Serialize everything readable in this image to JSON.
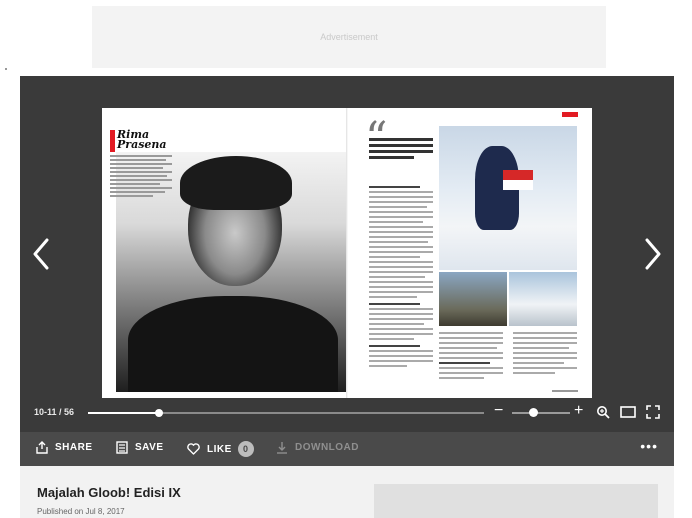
{
  "ad": {
    "label": "Advertisement"
  },
  "viewer": {
    "page_indicator": "10-11 / 56",
    "progress": 0.18,
    "zoom_level": 0.2,
    "magazine": {
      "brand_name_line1": "Rima",
      "brand_name_line2": "Prasena",
      "accent_color": "#e21b23"
    }
  },
  "actions": {
    "share_label": "SHARE",
    "save_label": "SAVE",
    "like_label": "LIKE",
    "like_count": "0",
    "download_label": "DOWNLOAD",
    "more_label": "•••"
  },
  "publication": {
    "title": "Majalah Gloob! Edisi IX",
    "published": "Published on Jul 8, 2017"
  },
  "icons": [
    "chevron-left-icon",
    "chevron-right-icon",
    "zoom-in-icon",
    "single-page-icon",
    "fullscreen-icon",
    "share-icon",
    "save-icon",
    "heart-icon",
    "download-icon",
    "more-icon"
  ]
}
